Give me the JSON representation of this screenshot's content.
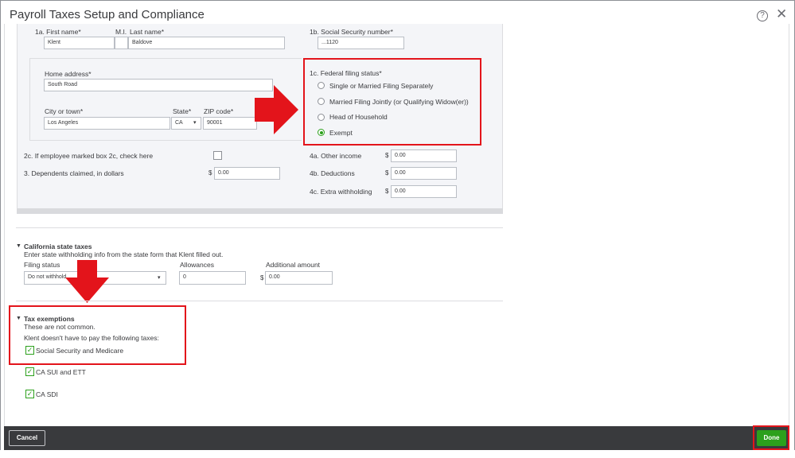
{
  "dialog": {
    "title": "Payroll Taxes Setup and Compliance",
    "help_icon": "help-circle-icon",
    "close_icon": "close-icon",
    "help_glyph": "?",
    "close_glyph": "✕"
  },
  "w4": {
    "first_name_label": "1a. First name*",
    "mi_label": "M.I.",
    "last_name_label": "Last name*",
    "first_name_value": "Klent",
    "mi_value": "",
    "last_name_value": "Baldove",
    "ssn_label": "1b. Social Security number*",
    "ssn_value": "...1120",
    "home_address_label": "Home address*",
    "home_address_value": "South Road",
    "city_label": "City or town*",
    "city_value": "Los Angeles",
    "state_label": "State*",
    "state_value": "CA",
    "zip_label": "ZIP code*",
    "zip_value": "90001",
    "filing_status_label": "1c. Federal filing status*",
    "filing_options": [
      {
        "label": "Single or Married Filing Separately",
        "selected": false
      },
      {
        "label": "Married Filing Jointly (or Qualifying Widow(er))",
        "selected": false
      },
      {
        "label": "Head of Household",
        "selected": false
      },
      {
        "label": "Exempt",
        "selected": true
      }
    ],
    "box2c_label": "2c. If employee marked box 2c, check here",
    "box2c_checked": false,
    "dependents_label": "3.  Dependents claimed, in dollars",
    "dependents_value": "0.00",
    "other_income_label": "4a. Other income",
    "other_income_value": "0.00",
    "deductions_label": "4b. Deductions",
    "deductions_value": "0.00",
    "extra_withholding_label": "4c. Extra withholding",
    "extra_withholding_value": "0.00",
    "currency_symbol": "$"
  },
  "state_taxes": {
    "title": "California state taxes",
    "description": "Enter state withholding info from the state form that Klent filled out.",
    "filing_status_label": "Filing status",
    "filing_status_value": "Do not withhold",
    "allowances_label": "Allowances",
    "allowances_value": "0",
    "additional_amount_label": "Additional amount",
    "additional_amount_value": "0.00"
  },
  "exemptions": {
    "title": "Tax exemptions",
    "note": "These are not common.",
    "description": "Klent doesn't have to pay the following taxes:",
    "items": [
      {
        "label": "Social Security and Medicare",
        "checked": true
      },
      {
        "label": "CA SUI and ETT",
        "checked": true
      },
      {
        "label": "CA SDI",
        "checked": true
      }
    ]
  },
  "footer": {
    "cancel_label": "Cancel",
    "done_label": "Done"
  },
  "glyphs": {
    "collapse": "▼",
    "dropdown": "▾",
    "check": "✓"
  },
  "colors": {
    "accent_green": "#2ca01c",
    "highlight_red": "#e3141b",
    "footer_bg": "#393a3d"
  }
}
